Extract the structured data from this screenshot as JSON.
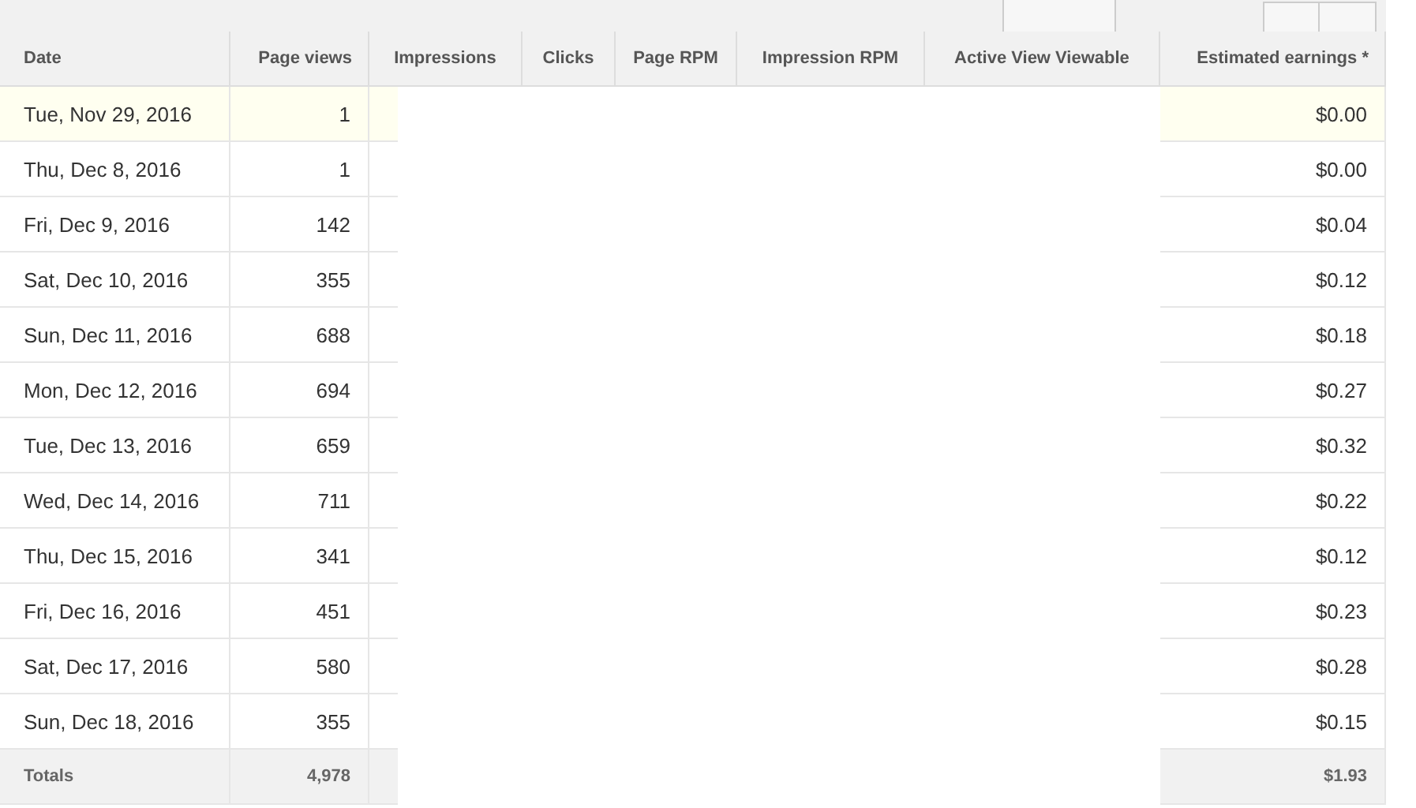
{
  "table": {
    "columns": [
      "Date",
      "Page views",
      "Impressions",
      "Clicks",
      "Page RPM",
      "Impression RPM",
      "Active View Viewable",
      "Estimated earnings *"
    ],
    "rows": [
      {
        "date": "Tue, Nov 29, 2016",
        "page_views": "1",
        "earnings": "$0.00",
        "selected": true
      },
      {
        "date": "Thu, Dec 8, 2016",
        "page_views": "1",
        "earnings": "$0.00",
        "selected": false
      },
      {
        "date": "Fri, Dec 9, 2016",
        "page_views": "142",
        "earnings": "$0.04",
        "selected": false
      },
      {
        "date": "Sat, Dec 10, 2016",
        "page_views": "355",
        "earnings": "$0.12",
        "selected": false
      },
      {
        "date": "Sun, Dec 11, 2016",
        "page_views": "688",
        "earnings": "$0.18",
        "selected": false
      },
      {
        "date": "Mon, Dec 12, 2016",
        "page_views": "694",
        "earnings": "$0.27",
        "selected": false
      },
      {
        "date": "Tue, Dec 13, 2016",
        "page_views": "659",
        "earnings": "$0.32",
        "selected": false
      },
      {
        "date": "Wed, Dec 14, 2016",
        "page_views": "711",
        "earnings": "$0.22",
        "selected": false
      },
      {
        "date": "Thu, Dec 15, 2016",
        "page_views": "341",
        "earnings": "$0.12",
        "selected": false
      },
      {
        "date": "Fri, Dec 16, 2016",
        "page_views": "451",
        "earnings": "$0.23",
        "selected": false
      },
      {
        "date": "Sat, Dec 17, 2016",
        "page_views": "580",
        "earnings": "$0.28",
        "selected": false
      },
      {
        "date": "Sun, Dec 18, 2016",
        "page_views": "355",
        "earnings": "$0.15",
        "selected": false
      }
    ],
    "totals": {
      "label": "Totals",
      "page_views": "4,978",
      "earnings": "$1.93"
    }
  }
}
